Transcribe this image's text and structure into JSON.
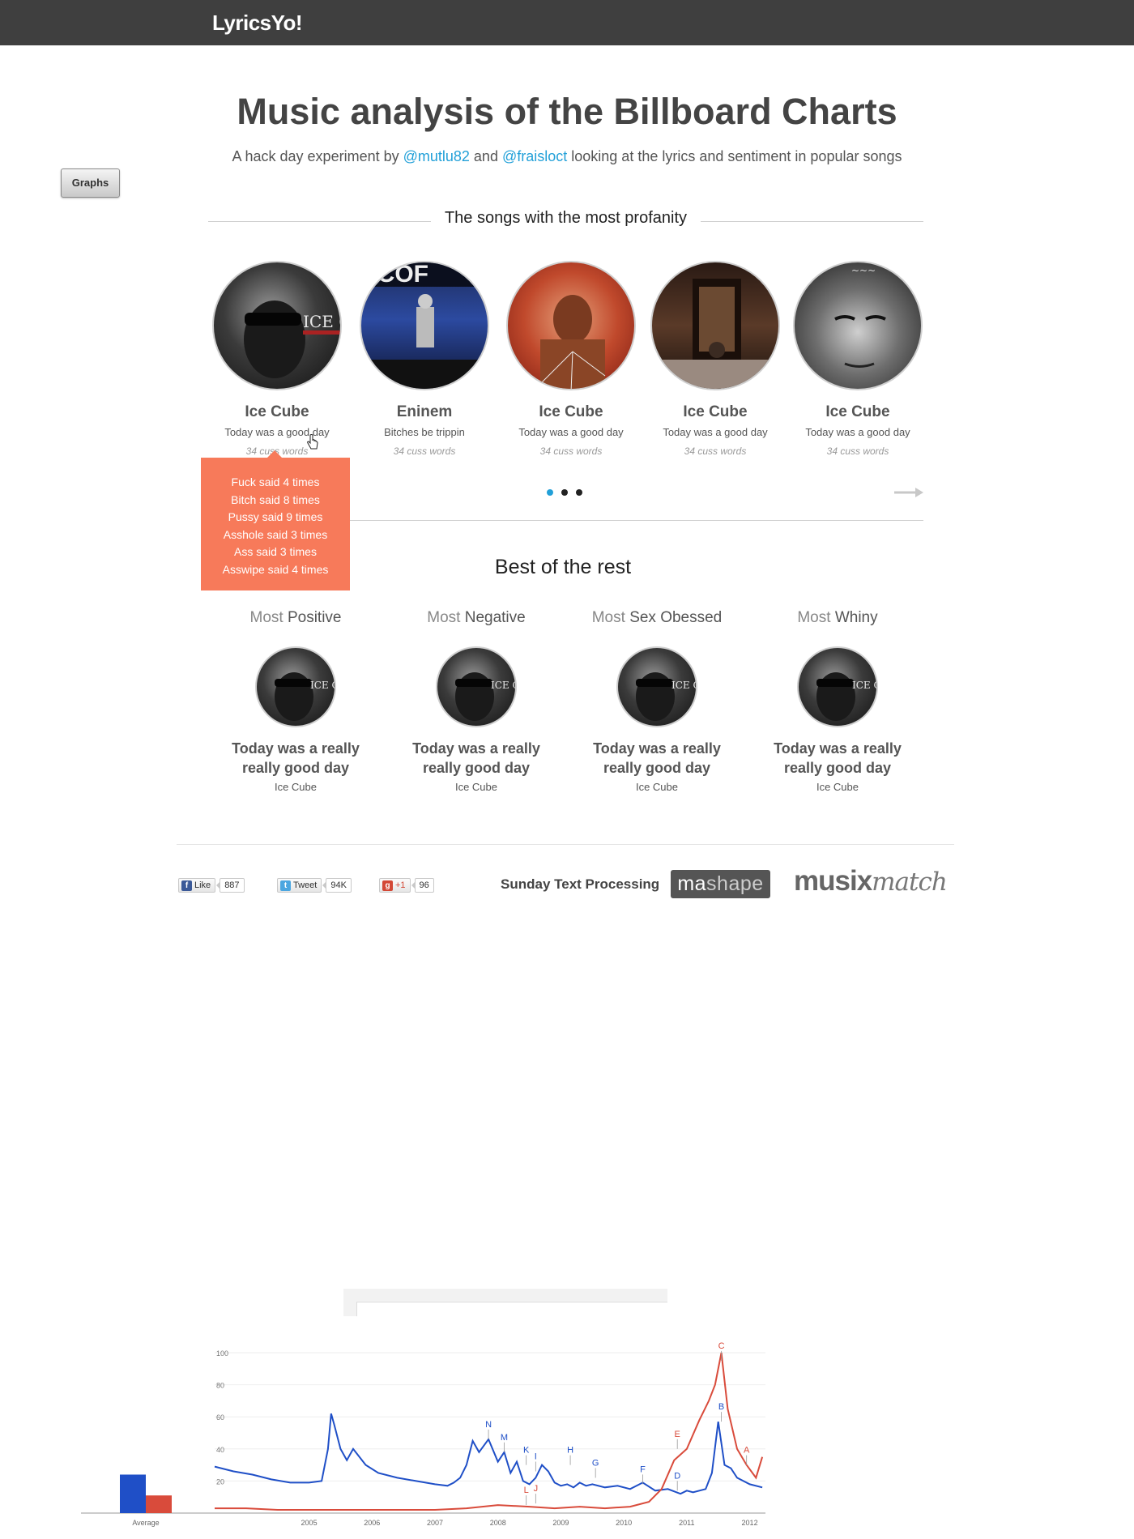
{
  "header": {
    "brand": "LyricsYo!"
  },
  "graphs_button": {
    "label": "Graphs"
  },
  "hero": {
    "title": "Music analysis of the Billboard Charts",
    "subtitle_before": "A hack day experiment by ",
    "author1": "@mutlu82",
    "subtitle_and": " and ",
    "author2": "@fraisloct",
    "subtitle_after": " looking at the lyrics and sentiment in popular songs"
  },
  "profanity": {
    "heading": "The songs with the most profanity",
    "songs": [
      {
        "artist": "Ice Cube",
        "song": "Today was a good day",
        "count": "34 cuss words"
      },
      {
        "artist": "Eninem",
        "song": "Bitches be trippin",
        "count": "34 cuss words"
      },
      {
        "artist": "Ice Cube",
        "song": "Today was a good day",
        "count": "34 cuss words"
      },
      {
        "artist": "Ice Cube",
        "song": "Today was a good day",
        "count": "34 cuss words"
      },
      {
        "artist": "Ice Cube",
        "song": "Today was a good day",
        "count": "34 cuss words"
      }
    ],
    "tooltip": [
      "Fuck said 4 times",
      "Bitch said 8 times",
      "Pussy said 9 times",
      "Asshole said 3 times",
      "Ass said 3 times",
      "Asswipe said 4 times"
    ],
    "pager": {
      "pages": 3,
      "active": 1
    }
  },
  "rest": {
    "heading": "Best of the rest",
    "items": [
      {
        "prefix": "Most",
        "label": "Positive",
        "title_line1": "Today was a really",
        "title_line2": "really good day",
        "artist": "Ice Cube"
      },
      {
        "prefix": "Most",
        "label": "Negative",
        "title_line1": "Today was a really",
        "title_line2": "really good day",
        "artist": "Ice Cube"
      },
      {
        "prefix": "Most",
        "label": "Sex Obessed",
        "title_line1": "Today was a really",
        "title_line2": "really good day",
        "artist": "Ice Cube"
      },
      {
        "prefix": "Most",
        "label": "Whiny",
        "title_line1": "Today was a really",
        "title_line2": "really good day",
        "artist": "Ice Cube"
      }
    ]
  },
  "footer": {
    "facebook": {
      "label": "Like",
      "count": "887"
    },
    "twitter": {
      "label": "Tweet",
      "count": "94K"
    },
    "gplus": {
      "label": "+1",
      "count": "96"
    },
    "sponsor_text": "Sunday Text Processing",
    "mashape": {
      "part1": "ma",
      "part2": "shape"
    },
    "musixmatch": {
      "part1": "musix",
      "part2": "match"
    }
  },
  "chart_data": {
    "type": "line",
    "x_labels": [
      "2005",
      "2006",
      "2007",
      "2008",
      "2009",
      "2010",
      "2011",
      "2012"
    ],
    "y_ticks": [
      20,
      40,
      60,
      80,
      100
    ],
    "ylim": [
      0,
      100
    ],
    "average_label": "Average",
    "average": [
      {
        "name": "blue",
        "value": 24
      },
      {
        "name": "red",
        "value": 11
      }
    ],
    "series": [
      {
        "color": "#1f4fc7",
        "x": [
          2004.0,
          2004.3,
          2004.6,
          2004.9,
          2005.2,
          2005.5,
          2005.7,
          2005.8,
          2005.85,
          2005.9,
          2006.0,
          2006.1,
          2006.2,
          2006.4,
          2006.6,
          2006.9,
          2007.2,
          2007.5,
          2007.7,
          2007.8,
          2007.9,
          2008.0,
          2008.1,
          2008.2,
          2008.35,
          2008.5,
          2008.6,
          2008.7,
          2008.8,
          2008.9,
          2009.0,
          2009.1,
          2009.2,
          2009.3,
          2009.4,
          2009.5,
          2009.6,
          2009.7,
          2009.8,
          2009.9,
          2010.0,
          2010.2,
          2010.4,
          2010.6,
          2010.8,
          2011.0,
          2011.2,
          2011.4,
          2011.5,
          2011.6,
          2011.8,
          2011.9,
          2012.0,
          2012.1,
          2012.2,
          2012.3,
          2012.5,
          2012.7
        ],
        "y": [
          29,
          26,
          24,
          21,
          19,
          19,
          20,
          40,
          62,
          55,
          40,
          33,
          40,
          30,
          25,
          22,
          20,
          18,
          17,
          19,
          22,
          30,
          45,
          38,
          46,
          32,
          38,
          25,
          32,
          20,
          18,
          22,
          30,
          26,
          19,
          17,
          18,
          16,
          19,
          17,
          18,
          16,
          17,
          15,
          19,
          14,
          15,
          12,
          14,
          13,
          15,
          25,
          57,
          30,
          28,
          22,
          18,
          16
        ]
      },
      {
        "color": "#d94b3b",
        "x": [
          2004.0,
          2004.5,
          2005.0,
          2005.5,
          2006.0,
          2006.5,
          2007.0,
          2007.5,
          2008.0,
          2008.5,
          2009.0,
          2009.4,
          2009.8,
          2010.2,
          2010.6,
          2010.9,
          2011.1,
          2011.3,
          2011.5,
          2011.7,
          2011.85,
          2011.95,
          2012.05,
          2012.15,
          2012.3,
          2012.45,
          2012.6,
          2012.7
        ],
        "y": [
          3,
          3,
          2,
          2,
          2,
          2,
          2,
          2,
          3,
          5,
          4,
          3,
          4,
          3,
          4,
          7,
          15,
          33,
          40,
          58,
          70,
          80,
          100,
          65,
          40,
          30,
          22,
          35
        ]
      }
    ],
    "annotations": [
      {
        "letter": "N",
        "x": 2008.35,
        "y": 46,
        "color": "#1f4fc7"
      },
      {
        "letter": "M",
        "x": 2008.6,
        "y": 38,
        "color": "#1f4fc7"
      },
      {
        "letter": "K",
        "x": 2008.95,
        "y": 30,
        "color": "#1f4fc7"
      },
      {
        "letter": "I",
        "x": 2009.1,
        "y": 26,
        "color": "#1f4fc7"
      },
      {
        "letter": "H",
        "x": 2009.65,
        "y": 30,
        "color": "#1f4fc7"
      },
      {
        "letter": "G",
        "x": 2010.05,
        "y": 22,
        "color": "#1f4fc7"
      },
      {
        "letter": "F",
        "x": 2010.8,
        "y": 18,
        "color": "#1f4fc7"
      },
      {
        "letter": "D",
        "x": 2011.35,
        "y": 14,
        "color": "#1f4fc7"
      },
      {
        "letter": "B",
        "x": 2012.05,
        "y": 57,
        "color": "#1f4fc7"
      },
      {
        "letter": "L",
        "x": 2008.95,
        "y": 5,
        "color": "#d94b3b"
      },
      {
        "letter": "J",
        "x": 2009.1,
        "y": 6,
        "color": "#d94b3b"
      },
      {
        "letter": "E",
        "x": 2011.35,
        "y": 40,
        "color": "#d94b3b"
      },
      {
        "letter": "A",
        "x": 2012.45,
        "y": 30,
        "color": "#d94b3b"
      },
      {
        "letter": "C",
        "x": 2012.05,
        "y": 95,
        "color": "#d94b3b"
      }
    ]
  }
}
